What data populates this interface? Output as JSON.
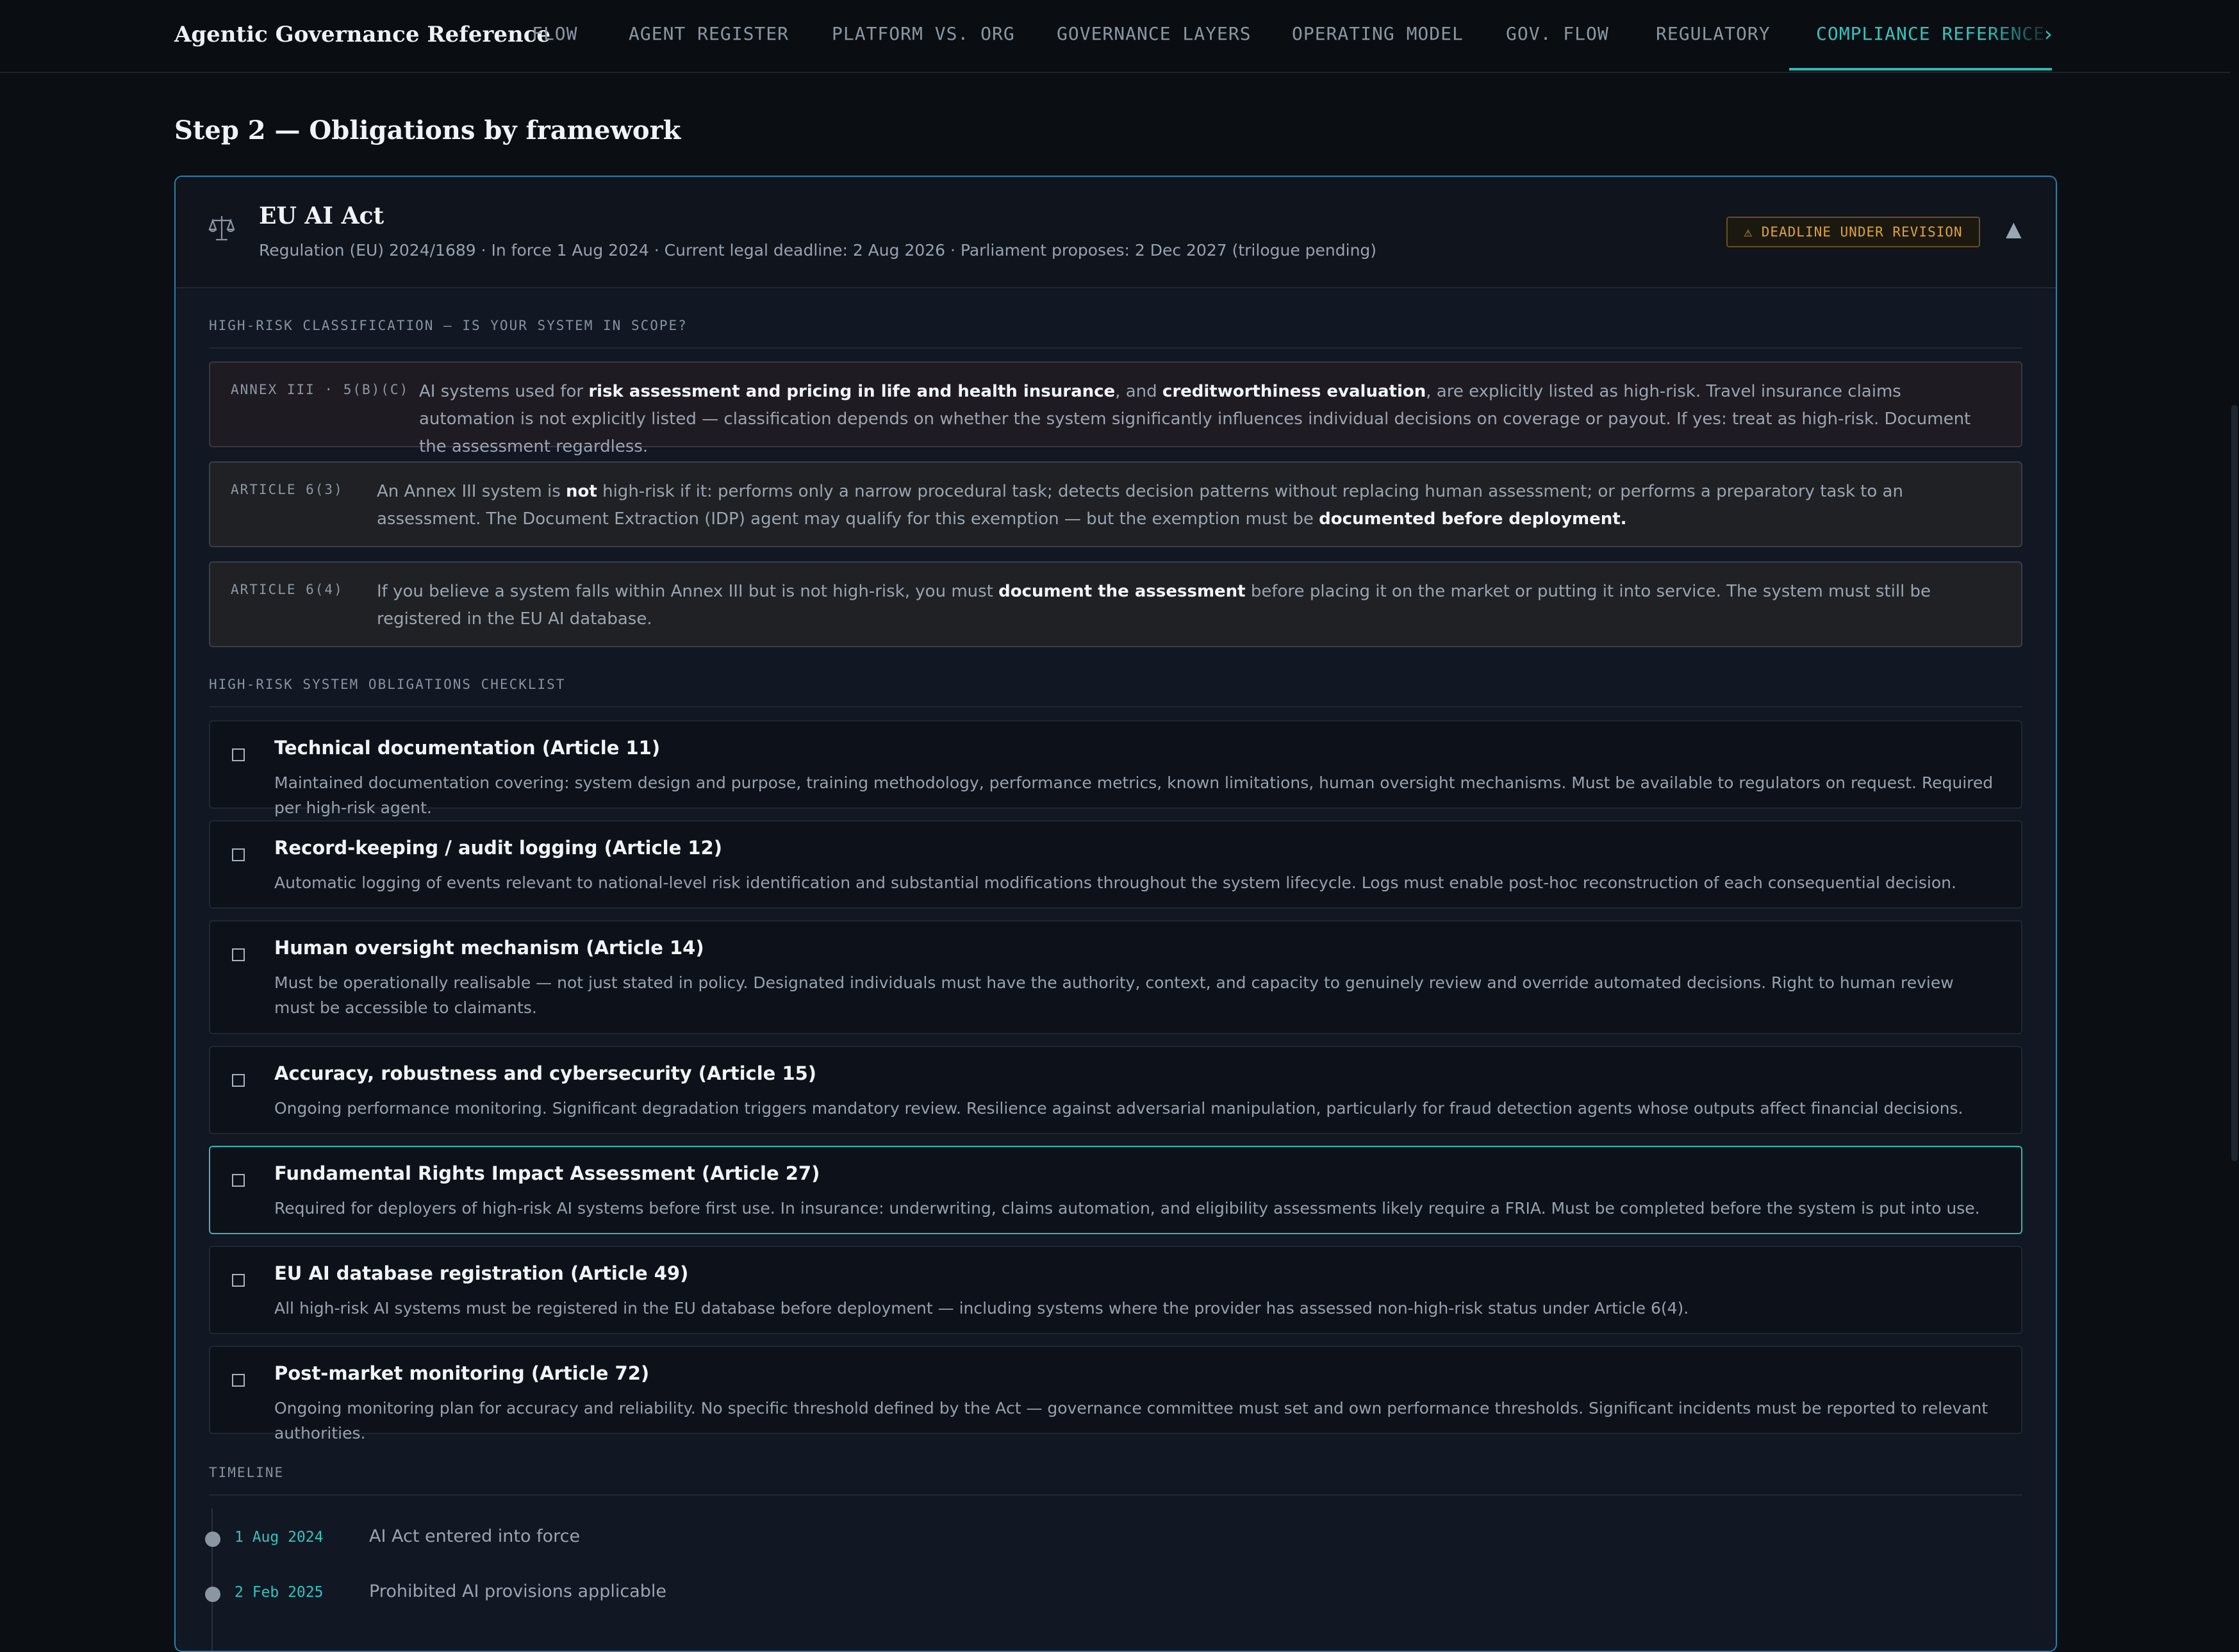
{
  "app": {
    "title": "Agentic Governance Reference"
  },
  "nav": {
    "tabs": [
      "FLOW",
      "AGENT REGISTER",
      "PLATFORM VS. ORG",
      "GOVERNANCE LAYERS",
      "OPERATING MODEL",
      "GOV. FLOW",
      "REGULATORY",
      "COMPLIANCE REFERENCE"
    ],
    "active_tab": "COMPLIANCE REFERENCE",
    "next_glyph": "›"
  },
  "page": {
    "step_title": "Step 2 — Obligations by framework"
  },
  "framework": {
    "name": "EU AI Act",
    "subtitle": "Regulation (EU) 2024/1689 · In force 1 Aug 2024 · Current legal deadline: 2 Aug 2026 · Parliament proposes: 2 Dec 2027 (trilogue pending)",
    "badge": "⚠ DEADLINE UNDER REVISION",
    "collapse_glyph": "▲",
    "icon": "scales-icon"
  },
  "classification": {
    "label": "HIGH-RISK CLASSIFICATION — IS YOUR SYSTEM IN SCOPE?",
    "notes": [
      {
        "tag": "ANNEX III · 5(B)(C)",
        "parts": [
          {
            "t": "AI systems used for "
          },
          {
            "t": "risk assessment and pricing in life and health insurance",
            "b": true
          },
          {
            "t": ", and "
          },
          {
            "t": "creditworthiness evaluation",
            "b": true
          },
          {
            "t": ", are explicitly listed as high-risk. Travel insurance claims automation is not explicitly listed — classification depends on whether the system significantly influences individual decisions on coverage or payout. If yes: treat as high-risk. Document the assessment regardless."
          }
        ]
      },
      {
        "tag": "ARTICLE 6(3)",
        "parts": [
          {
            "t": "An Annex III system is "
          },
          {
            "t": "not",
            "b": true
          },
          {
            "t": " high-risk if it: performs only a narrow procedural task; detects decision patterns without replacing human assessment; or performs a preparatory task to an assessment. The Document Extraction (IDP) agent may qualify for this exemption — but the exemption must be "
          },
          {
            "t": "documented before deployment.",
            "b": true
          }
        ]
      },
      {
        "tag": "ARTICLE 6(4)",
        "parts": [
          {
            "t": "If you believe a system falls within Annex III but is not high-risk, you must "
          },
          {
            "t": "document the assessment",
            "b": true
          },
          {
            "t": " before placing it on the market or putting it into service. The system must still be registered in the EU AI database."
          }
        ]
      }
    ]
  },
  "checklist": {
    "label": "HIGH-RISK SYSTEM OBLIGATIONS CHECKLIST",
    "items": [
      {
        "title": "Technical documentation (Article 11)",
        "desc": "Maintained documentation covering: system design and purpose, training methodology, performance metrics, known limitations, human oversight mechanisms. Must be available to regulators on request. Required per high-risk agent.",
        "checked": false
      },
      {
        "title": "Record-keeping / audit logging (Article 12)",
        "desc": "Automatic logging of events relevant to national-level risk identification and substantial modifications throughout the system lifecycle. Logs must enable post-hoc reconstruction of each consequential decision.",
        "checked": false
      },
      {
        "title": "Human oversight mechanism (Article 14)",
        "desc": "Must be operationally realisable — not just stated in policy. Designated individuals must have the authority, context, and capacity to genuinely review and override automated decisions. Right to human review must be accessible to claimants.",
        "checked": false
      },
      {
        "title": "Accuracy, robustness and cybersecurity (Article 15)",
        "desc": "Ongoing performance monitoring. Significant degradation triggers mandatory review. Resilience against adversarial manipulation, particularly for fraud detection agents whose outputs affect financial decisions.",
        "checked": false
      },
      {
        "title": "Fundamental Rights Impact Assessment (Article 27)",
        "desc": "Required for deployers of high-risk AI systems before first use. In insurance: underwriting, claims automation, and eligibility assessments likely require a FRIA. Must be completed before the system is put into use.",
        "checked": false
      },
      {
        "title": "EU AI database registration (Article 49)",
        "desc": "All high-risk AI systems must be registered in the EU database before deployment — including systems where the provider has assessed non-high-risk status under Article 6(4).",
        "checked": false
      },
      {
        "title": "Post-market monitoring (Article 72)",
        "desc": "Ongoing monitoring plan for accuracy and reliability. No specific threshold defined by the Act — governance committee must set and own performance thresholds. Significant incidents must be reported to relevant authorities.",
        "checked": false
      }
    ]
  },
  "timeline": {
    "label": "TIMELINE",
    "events": [
      {
        "date": "1 Aug 2024",
        "text": "AI Act entered into force"
      },
      {
        "date": "2 Feb 2025",
        "text": "Prohibited AI provisions applicable"
      }
    ]
  },
  "colors": {
    "background": "#0b0f14",
    "accent": "#35c3bd",
    "warning": "#e0a23a",
    "card_border": "#2e7fa6"
  }
}
